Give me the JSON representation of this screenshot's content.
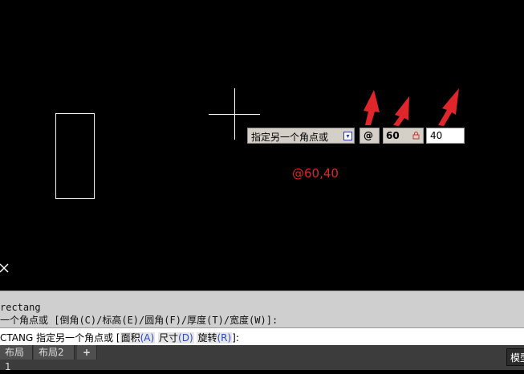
{
  "canvas": {
    "prompt_label": "指定另一个角点或",
    "at_field": "@",
    "x_field": "60",
    "y_field": "40",
    "annotation": "@60,40",
    "annotation_color": "#e0262a",
    "arrow_color": "#e0262a"
  },
  "command_line": {
    "history_1": "rectang",
    "history_2": "一个角点或 [倒角(C)/标高(E)/圆角(F)/厚度(T)/宽度(W)]:",
    "input_prefix": "CTANG 指定另一个角点或 [",
    "options": [
      {
        "label": "面积",
        "key": "(A)"
      },
      {
        "label": "尺寸",
        "key": "(D)"
      },
      {
        "label": "旋转",
        "key": "(R)"
      }
    ],
    "input_suffix": "]:",
    "option_key_color": "#2b49c6"
  },
  "tabs": {
    "items": [
      "布局1",
      "布局2"
    ],
    "add": "+",
    "model_button": "模型"
  }
}
